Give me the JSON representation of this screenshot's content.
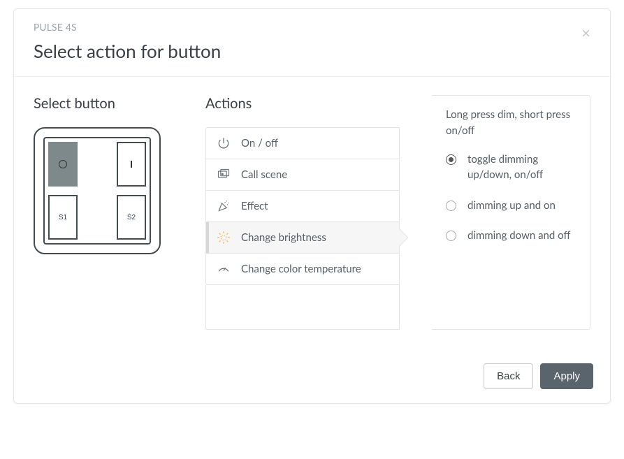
{
  "header": {
    "eyebrow": "PULSE 4S",
    "title": "Select action for button",
    "close_label": "×"
  },
  "columns": {
    "select_button_heading": "Select button",
    "actions_heading": "Actions"
  },
  "device": {
    "buttons": {
      "top_left": "O",
      "top_right": "I",
      "bottom_left": "S1",
      "bottom_right": "S2"
    },
    "selected": "top_left"
  },
  "action_list": [
    {
      "id": "onoff",
      "label": "On / off",
      "icon": "power-icon",
      "selected": false
    },
    {
      "id": "callscene",
      "label": "Call scene",
      "icon": "scene-icon",
      "selected": false
    },
    {
      "id": "effect",
      "label": "Effect",
      "icon": "confetti-icon",
      "selected": false
    },
    {
      "id": "brightness",
      "label": "Change brightness",
      "icon": "brightness-icon",
      "selected": true
    },
    {
      "id": "cct",
      "label": "Change color temperature",
      "icon": "temperature-icon",
      "selected": false
    }
  ],
  "detail": {
    "description": "Long press dim, short press on/off",
    "options": [
      {
        "id": "toggle",
        "label": "toggle dimming up/down, on/off",
        "checked": true
      },
      {
        "id": "upon",
        "label": "dimming up and on",
        "checked": false
      },
      {
        "id": "dnoff",
        "label": "dimming down and off",
        "checked": false
      }
    ]
  },
  "footer": {
    "back": "Back",
    "apply": "Apply"
  }
}
